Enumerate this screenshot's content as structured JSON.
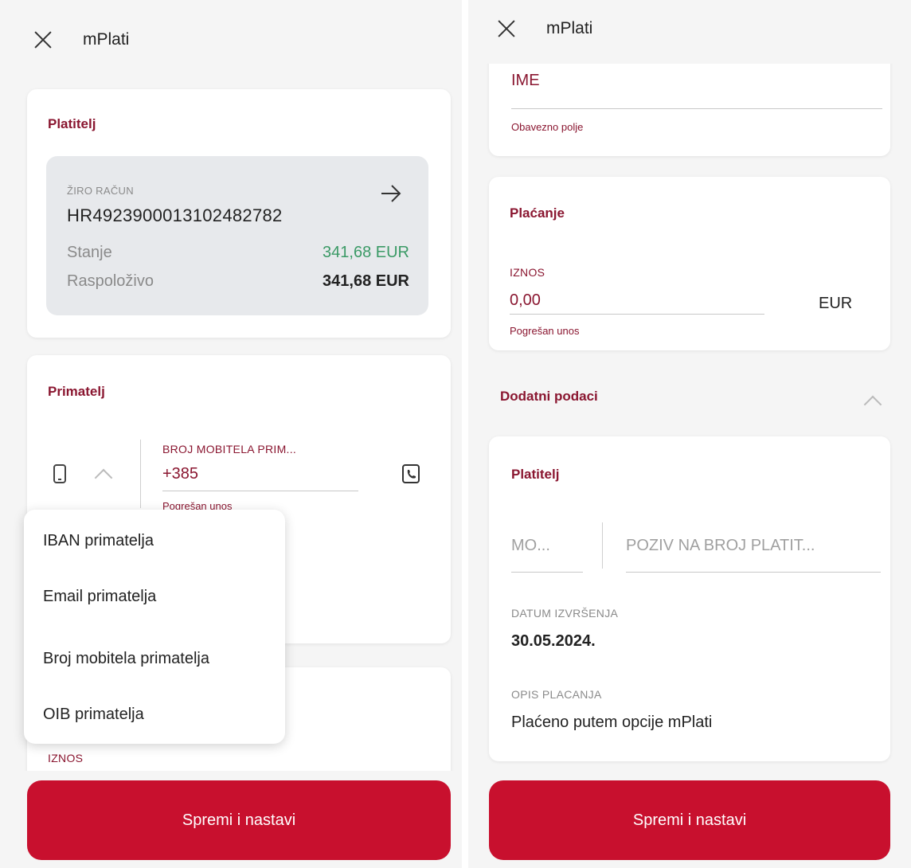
{
  "left": {
    "header": {
      "title": "mPlati"
    },
    "payer": {
      "section_title": "Platitelj",
      "account_type": "ŽIRO RAČUN",
      "iban": "HR4923900013102482782",
      "balance_label": "Stanje",
      "balance_value": "341,68 EUR",
      "available_label": "Raspoloživo",
      "available_value": "341,68 EUR"
    },
    "recipient": {
      "section_title": "Primatelj",
      "field_label": "BROJ MOBITELA PRIM...",
      "field_value": "+385",
      "error": "Pogrešan unos"
    },
    "dropdown": {
      "items": [
        {
          "label": "IBAN primatelja"
        },
        {
          "label": "Email primatelja"
        },
        {
          "label": "Broj mobitela primatelja"
        },
        {
          "label": "OIB primatelja"
        }
      ]
    },
    "partial": {
      "amount_label": "IZNOS"
    },
    "save_button": "Spremi i nastavi"
  },
  "right": {
    "header": {
      "title": "mPlati"
    },
    "name": {
      "value": "IME",
      "hint": "Obavezno polje"
    },
    "payment": {
      "section_title": "Plaćanje",
      "amount_label": "IZNOS",
      "amount_value": "0,00",
      "currency": "EUR",
      "error": "Pogrešan unos"
    },
    "additional": {
      "title": "Dodatni podaci",
      "payer_title": "Platitelj",
      "model_placeholder": "MO...",
      "reference_placeholder": "POZIV NA BROJ PLATIT...",
      "date_label": "DATUM IZVRŠENJA",
      "date_value": "30.05.2024.",
      "desc_label": "OPIS PLACANJA",
      "desc_value": "Plaćeno putem opcije mPlati"
    },
    "save_button": "Spremi i nastavi"
  },
  "colors": {
    "brand_red": "#c8102e",
    "section_red": "#8a1630",
    "balance_green": "#3b9a66"
  }
}
